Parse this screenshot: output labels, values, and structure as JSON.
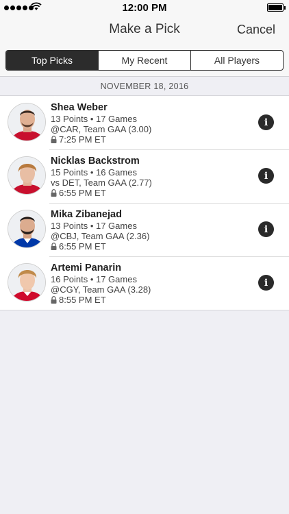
{
  "status": {
    "time": "12:00 PM"
  },
  "nav": {
    "title": "Make a Pick",
    "cancel_label": "Cancel"
  },
  "tabs": [
    {
      "label": "Top Picks",
      "active": true
    },
    {
      "label": "My Recent",
      "active": false
    },
    {
      "label": "All Players",
      "active": false
    }
  ],
  "date_header": "NOVEMBER 18, 2016",
  "players": [
    {
      "name": "Shea Weber",
      "stats": "13 Points • 17 Games",
      "matchup": "@CAR, Team GAA (3.00)",
      "time": "7:25 PM ET",
      "jersey_color": "#c8102e"
    },
    {
      "name": "Nicklas Backstrom",
      "stats": "15 Points • 16 Games",
      "matchup": "vs DET, Team GAA (2.77)",
      "time": "6:55 PM ET",
      "jersey_color": "#c8102e"
    },
    {
      "name": "Mika Zibanejad",
      "stats": "13 Points • 17 Games",
      "matchup": "@CBJ, Team GAA (2.36)",
      "time": "6:55 PM ET",
      "jersey_color": "#0038a8"
    },
    {
      "name": "Artemi Panarin",
      "stats": "16 Points • 17 Games",
      "matchup": "@CGY, Team GAA (3.28)",
      "time": "8:55 PM ET",
      "jersey_color": "#cf0a2c"
    }
  ],
  "colors": {
    "accent": "#2c2c2c",
    "background": "#efeff4"
  }
}
